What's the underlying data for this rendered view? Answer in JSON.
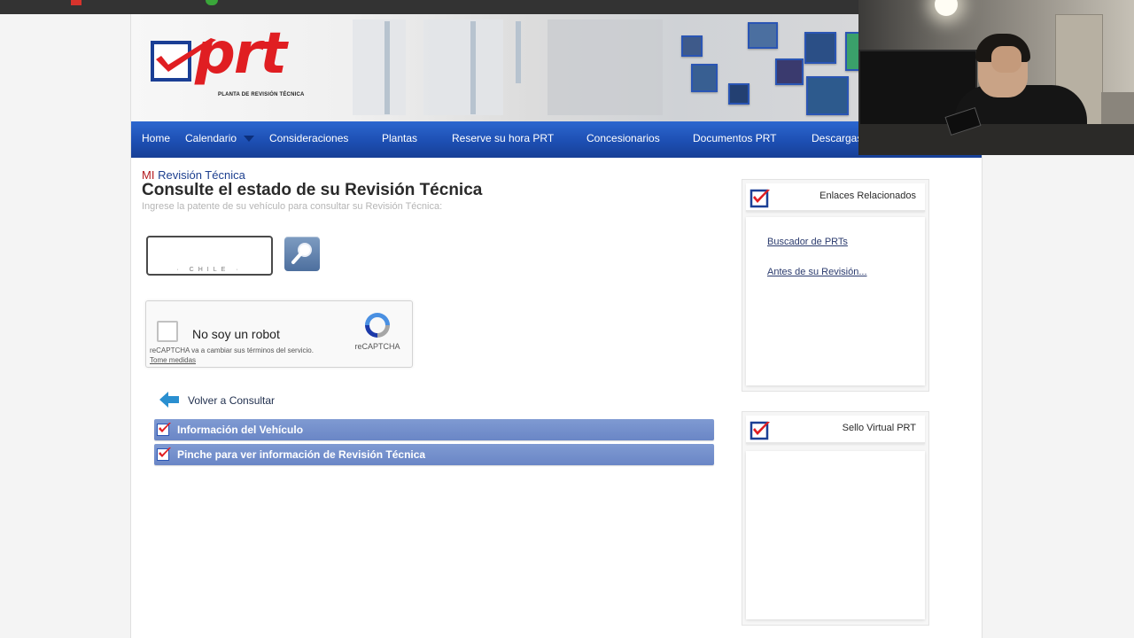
{
  "banner": {
    "logo_text": "prt",
    "logo_subtitle": "PLANTA DE REVISIÓN TÉCNICA"
  },
  "nav": {
    "items": [
      {
        "label": "Home"
      },
      {
        "label": "Calendario",
        "has_dropdown": true
      },
      {
        "label": "Consideraciones"
      },
      {
        "label": "Plantas"
      },
      {
        "label": "Reserve su hora PRT"
      },
      {
        "label": "Concesionarios"
      },
      {
        "label": "Documentos PRT"
      },
      {
        "label": "Descargas"
      }
    ]
  },
  "main": {
    "breadcrumb_prefix": "MI",
    "breadcrumb_text": "Revisión Técnica",
    "title": "Consulte el estado de su Revisión Técnica",
    "hint": "Ingrese la patente de su vehículo para consultar su Revisión Técnica:",
    "plate": {
      "value": "",
      "country": "· CHILE ·"
    },
    "search_icon": "magnifier-icon",
    "back_label": "Volver a Consultar",
    "sections": [
      {
        "label": "Información del Vehículo"
      },
      {
        "label": "Pinche para ver información de Revisión Técnica"
      }
    ]
  },
  "recaptcha": {
    "label": "No soy un robot",
    "brand": "reCAPTCHA",
    "terms_text": "reCAPTCHA va a cambiar sus términos del servicio.",
    "terms_link": "Tome medidas"
  },
  "sidebar": {
    "boxes": [
      {
        "title": "Enlaces Relacionados",
        "links": [
          {
            "label": "Buscador de PRTs"
          },
          {
            "label": "Antes de su Revisión..."
          }
        ]
      },
      {
        "title": "Sello Virtual PRT",
        "links": []
      }
    ]
  },
  "colors": {
    "nav_blue": "#1d4fb3",
    "logo_red": "#e01e22",
    "logo_blue": "#1b3f95",
    "section_bar": "#6a86c6"
  }
}
